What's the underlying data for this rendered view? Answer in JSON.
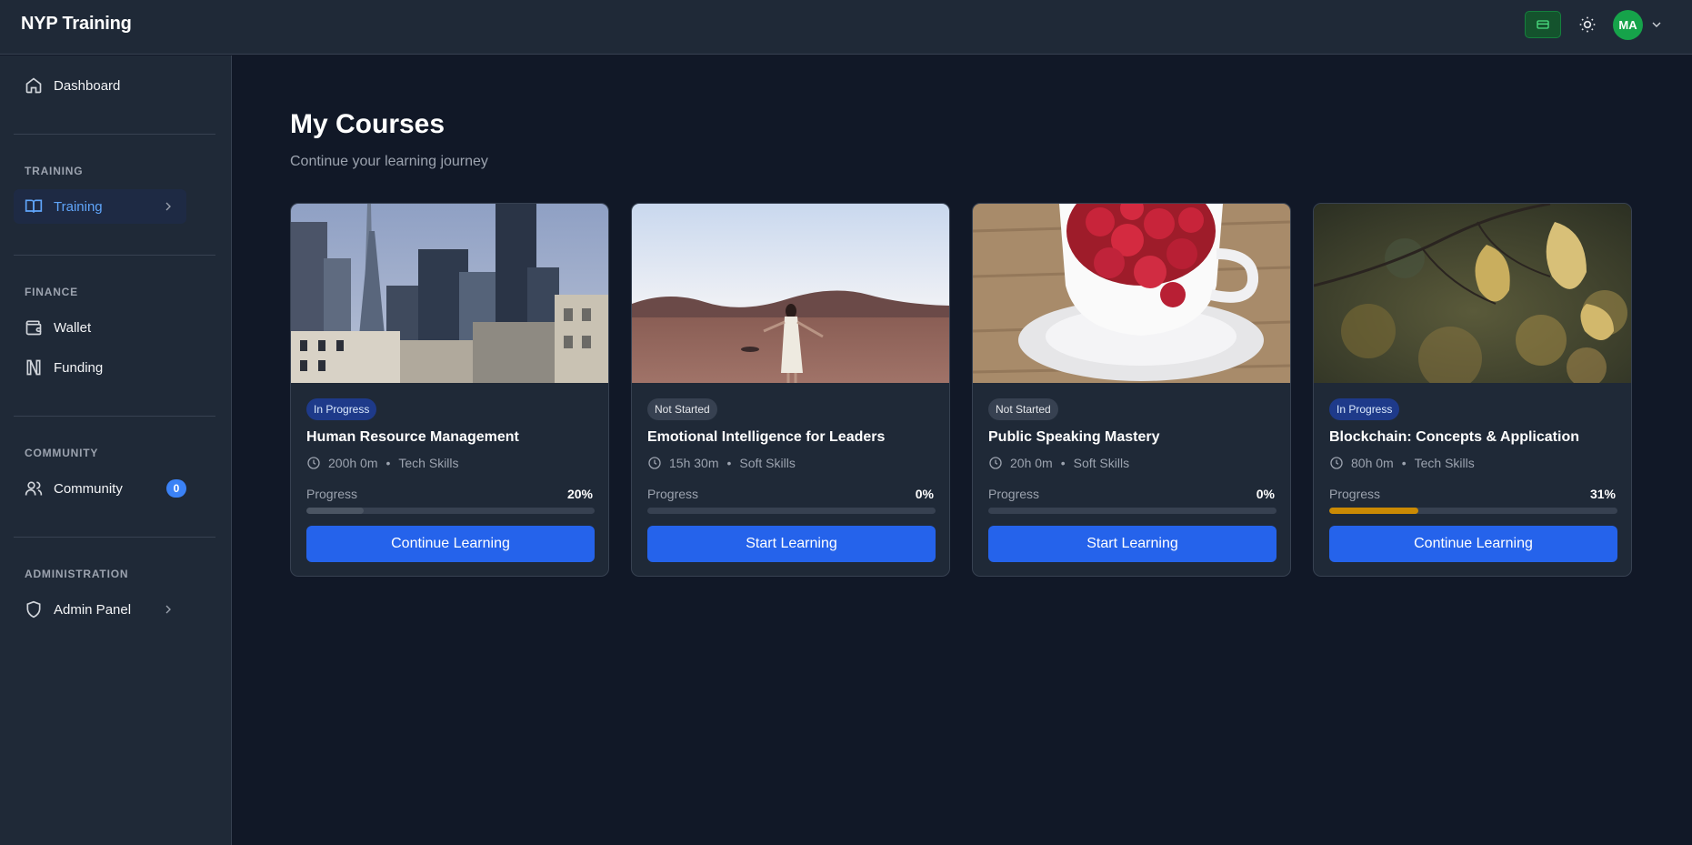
{
  "header": {
    "brand": "NYP Training",
    "avatar_initials": "MA"
  },
  "sidebar": {
    "dashboard": "Dashboard",
    "sections": {
      "training": "TRAINING",
      "finance": "FINANCE",
      "community": "COMMUNITY",
      "administration": "ADMINISTRATION"
    },
    "items": {
      "training": "Training",
      "wallet": "Wallet",
      "funding": "Funding",
      "community": "Community",
      "community_badge": "0",
      "admin": "Admin Panel"
    }
  },
  "main": {
    "title": "My Courses",
    "subtitle": "Continue your learning journey",
    "progress_label": "Progress"
  },
  "courses": [
    {
      "status": "In Progress",
      "title": "Human Resource Management",
      "duration": "200h 0m",
      "category": "Tech Skills",
      "progress_pct": "20%",
      "progress": 0.2,
      "cta": "Continue Learning",
      "bar_color": "#4b5563"
    },
    {
      "status": "Not Started",
      "title": "Emotional Intelligence for Leaders",
      "duration": "15h 30m",
      "category": "Soft Skills",
      "progress_pct": "0%",
      "progress": 0,
      "cta": "Start Learning",
      "bar_color": "#4b5563"
    },
    {
      "status": "Not Started",
      "title": "Public Speaking Mastery",
      "duration": "20h 0m",
      "category": "Soft Skills",
      "progress_pct": "0%",
      "progress": 0,
      "cta": "Start Learning",
      "bar_color": "#4b5563"
    },
    {
      "status": "In Progress",
      "title": "Blockchain: Concepts & Application",
      "duration": "80h 0m",
      "category": "Tech Skills",
      "progress_pct": "31%",
      "progress": 0.31,
      "cta": "Continue Learning",
      "bar_color": "#ca8a04"
    }
  ],
  "separator": "•"
}
